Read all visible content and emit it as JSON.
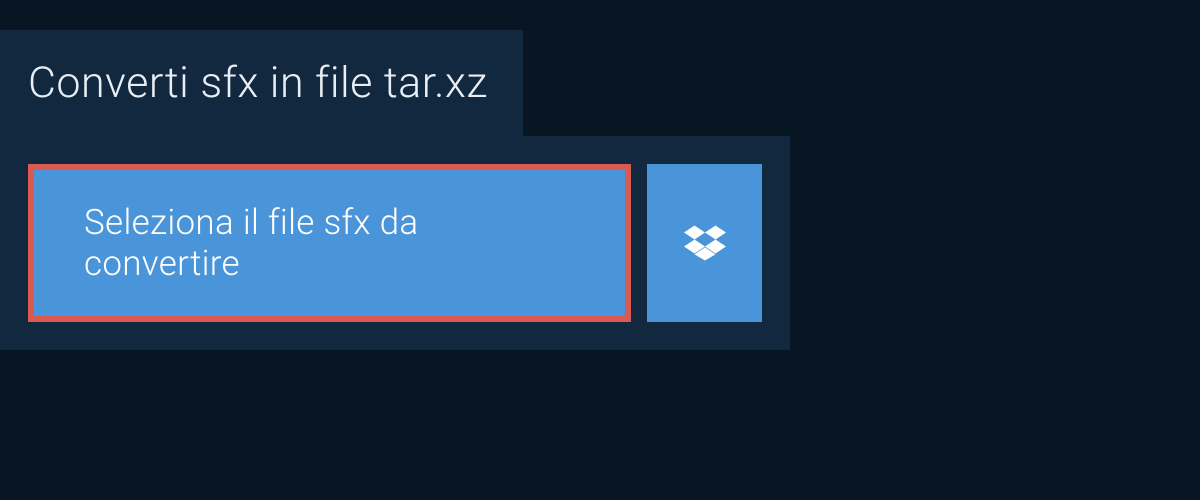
{
  "header": {
    "title": "Converti sfx in file tar.xz"
  },
  "actions": {
    "select_file_label": "Seleziona il file sfx da convertire"
  },
  "colors": {
    "background": "#081624",
    "panel": "#12283f",
    "button": "#4a94d9",
    "highlight_border": "#d95a50"
  }
}
